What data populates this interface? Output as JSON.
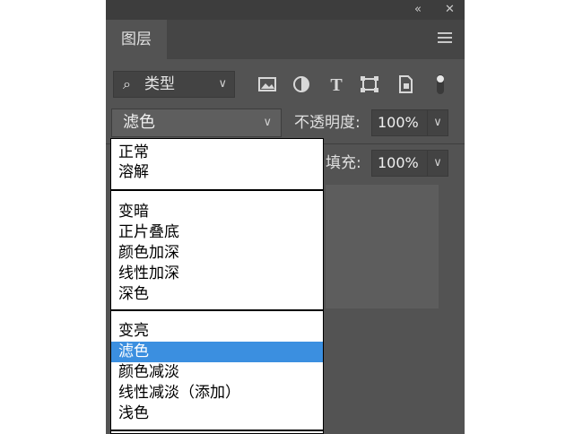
{
  "panel": {
    "tab_label": "图层",
    "collapse_icon": "double-chevron-left-icon",
    "close_icon": "close-icon",
    "menu_icon": "panel-menu-icon"
  },
  "filter": {
    "label": "类型",
    "icons": [
      "image-filter-icon",
      "adjustment-filter-icon",
      "type-filter-icon",
      "shape-filter-icon",
      "smart-object-filter-icon",
      "filter-toggle-icon"
    ]
  },
  "blend": {
    "selected": "滤色",
    "opacity_label": "不透明度:",
    "opacity_value": "100%",
    "fill_label": "填充:",
    "fill_value": "100%"
  },
  "dropdown": {
    "group1": [
      "正常",
      "溶解"
    ],
    "group2": [
      "变暗",
      "正片叠底",
      "颜色加深",
      "线性加深",
      "深色"
    ],
    "group3": [
      "变亮",
      "滤色",
      "颜色减淡",
      "线性减淡（添加）",
      "浅色"
    ],
    "selected": "滤色"
  },
  "colors": {
    "panel_bg": "#535353",
    "highlight": "#3b8fe0"
  }
}
